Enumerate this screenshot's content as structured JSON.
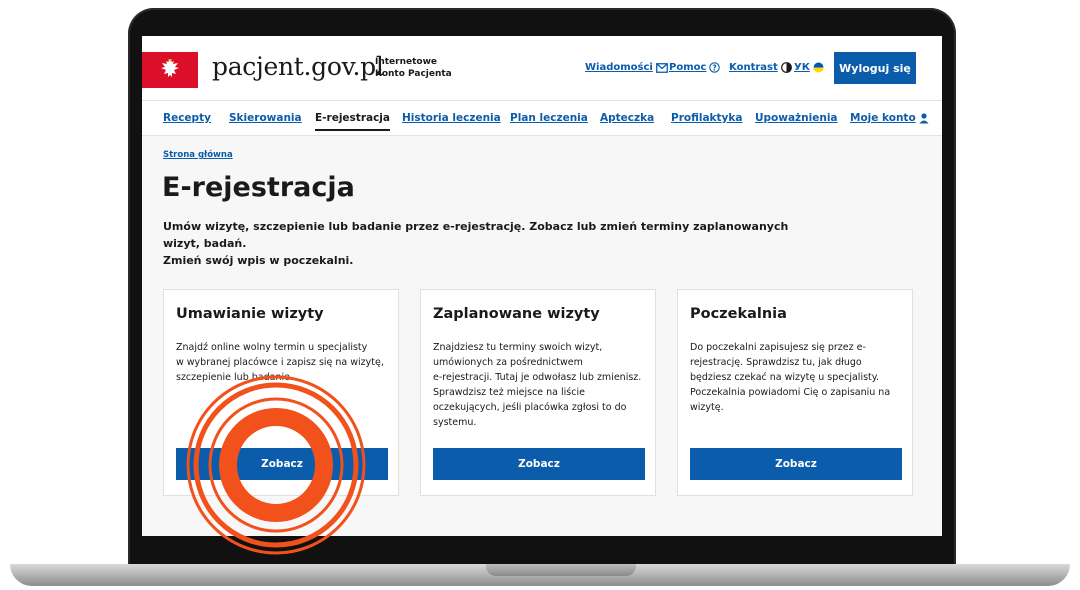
{
  "header": {
    "site_name": "pacjent.gov.pl",
    "site_subtitle_line1": "Internetowe",
    "site_subtitle_line2": "Konto Pacjenta",
    "links": {
      "messages": "Wiadomości",
      "help": "Pomoc",
      "contrast": "Kontrast",
      "language": "УК"
    },
    "logout_label": "Wyloguj się"
  },
  "nav": {
    "items": [
      {
        "label": "Recepty"
      },
      {
        "label": "Skierowania"
      },
      {
        "label": "E-rejestracja"
      },
      {
        "label": "Historia leczenia"
      },
      {
        "label": "Plan leczenia"
      },
      {
        "label": "Apteczka"
      },
      {
        "label": "Profilaktyka"
      },
      {
        "label": "Upoważnienia"
      },
      {
        "label": "Moje konto"
      }
    ],
    "active": "E-rejestracja"
  },
  "breadcrumb": "Strona główna",
  "page": {
    "title": "E-rejestracja",
    "intro_line1": "Umów wizytę, szczepienie lub badanie przez e-rejestrację. Zobacz lub zmień terminy zaplanowanych wizyt, badań.",
    "intro_line2": "Zmień swój wpis w poczekalni."
  },
  "cards": [
    {
      "title": "Umawianie wizyty",
      "lines": [
        "Znajdź online wolny termin u specjalisty",
        "w wybranej placówce i zapisz się na wizytę,",
        "szczepienie lub badanie."
      ],
      "button": "Zobacz"
    },
    {
      "title": "Zaplanowane wizyty",
      "lines": [
        "Znajdziesz tu terminy swoich wizyt,",
        "umówionych za pośrednictwem",
        "e-rejestracji. Tutaj je odwołasz lub zmienisz.",
        "Sprawdzisz też miejsce na liście",
        "oczekujących, jeśli placówka zgłosi to do",
        "systemu."
      ],
      "button": "Zobacz"
    },
    {
      "title": "Poczekalnia",
      "lines": [
        "Do poczekalni zapisujesz się przez e-",
        "rejestrację. Sprawdzisz tu, jak długo",
        "będziesz czekać na wizytę u specjalisty.",
        "Poczekalnia powiadomi Cię o zapisaniu na",
        "wizytę."
      ],
      "button": "Zobacz"
    }
  ],
  "colors": {
    "primary": "#0b5cab",
    "emblem_red": "#dc0f2b",
    "highlight_ring": "#f2511b"
  },
  "icons": [
    "envelope-icon",
    "help-circle-icon",
    "contrast-icon",
    "ukraine-flag-icon",
    "user-icon",
    "eagle-emblem-icon"
  ]
}
